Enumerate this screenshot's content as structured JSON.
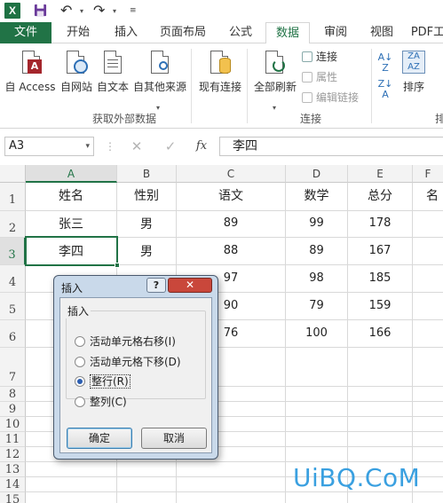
{
  "quick_access": {
    "app_icon": "excel-icon",
    "app_icon_text": "X",
    "save_icon": "save-icon",
    "undo_icon": "undo-icon",
    "redo_icon": "redo-icon",
    "customize_icon": "customize-qat-icon"
  },
  "tabs": {
    "file": "文件",
    "items": [
      "开始",
      "插入",
      "页面布局",
      "公式",
      "数据",
      "审阅",
      "视图",
      "PDF工"
    ],
    "active": "数据"
  },
  "ribbon": {
    "buttons": {
      "access": "自 Access",
      "web": "自网站",
      "text": "自文本",
      "other": "自其他来源",
      "existing": "现有连接",
      "refresh_all": "全部刷新",
      "sort": "排序"
    },
    "small": {
      "connections": "连接",
      "properties": "属性",
      "edit_links": "编辑链接"
    },
    "groups": {
      "external": "获取外部数据",
      "connections": "连接",
      "sort_cut": "排"
    }
  },
  "formula_bar": {
    "name_box": "A3",
    "cancel": "✕",
    "enter": "✓",
    "fx": "fx",
    "content": "李四"
  },
  "sheet": {
    "columns": [
      "A",
      "B",
      "C",
      "D",
      "E",
      "F"
    ],
    "rows": [
      "1",
      "2",
      "3",
      "4",
      "5",
      "6",
      "7",
      "8",
      "9",
      "10",
      "11",
      "12",
      "13",
      "14",
      "15"
    ],
    "header": [
      "姓名",
      "性别",
      "语文",
      "数学",
      "总分",
      "名"
    ],
    "data": [
      [
        "张三",
        "男",
        "89",
        "99",
        "178"
      ],
      [
        "李四",
        "男",
        "88",
        "89",
        "167"
      ],
      [
        "",
        "",
        "97",
        "98",
        "185"
      ],
      [
        "",
        "",
        "90",
        "79",
        "159"
      ],
      [
        "",
        "",
        "76",
        "100",
        "166"
      ]
    ],
    "selected_cell": "A3"
  },
  "dialog": {
    "title": "插入",
    "help": "?",
    "close": "✕",
    "group": "插入",
    "options": [
      {
        "label": "活动单元格右移(I)",
        "checked": false
      },
      {
        "label": "活动单元格下移(D)",
        "checked": false
      },
      {
        "label": "整行(R)",
        "checked": true
      },
      {
        "label": "整列(C)",
        "checked": false
      }
    ],
    "ok": "确定",
    "cancel": "取消"
  },
  "watermark": "UiBQ.CoM"
}
